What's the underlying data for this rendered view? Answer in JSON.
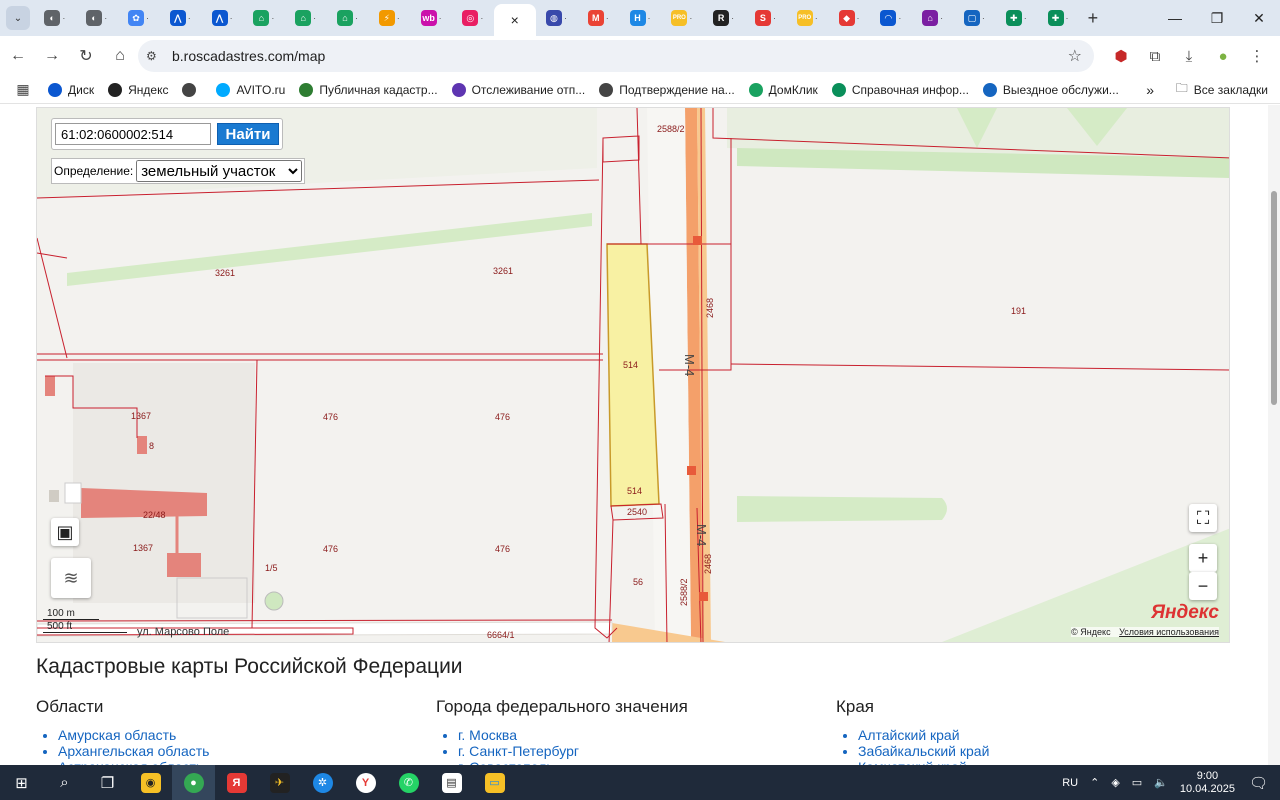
{
  "browser": {
    "address": "b.roscadastres.com/map",
    "tab_favicons": [
      {
        "color": "#5f6368",
        "glyph": "◐"
      },
      {
        "color": "#5f6368",
        "glyph": "◐"
      },
      {
        "color": "#4285f4",
        "glyph": "✿"
      },
      {
        "color": "#0b57d0",
        "glyph": "⋀"
      },
      {
        "color": "#0b57d0",
        "glyph": "⋀"
      },
      {
        "color": "#1aa260",
        "glyph": "⌂"
      },
      {
        "color": "#1aa260",
        "glyph": "⌂"
      },
      {
        "color": "#1aa260",
        "glyph": "⌂"
      },
      {
        "color": "#f29900",
        "glyph": "⚡"
      },
      {
        "color": "#cb11ab",
        "glyph": "wb"
      },
      {
        "color": "#e91e63",
        "glyph": "◎"
      },
      {
        "color": "#ffffff",
        "glyph": "×",
        "active": true
      },
      {
        "color": "#3949ab",
        "glyph": "◍"
      },
      {
        "color": "#ea4335",
        "glyph": "M"
      },
      {
        "color": "#1e88e5",
        "glyph": "H"
      },
      {
        "color": "#f6bf26",
        "glyph": "PRO"
      },
      {
        "color": "#222222",
        "glyph": "R"
      },
      {
        "color": "#e53935",
        "glyph": "S"
      },
      {
        "color": "#f6bf26",
        "glyph": "PRO"
      },
      {
        "color": "#e53935",
        "glyph": "◆"
      },
      {
        "color": "#0b57d0",
        "glyph": "◠"
      },
      {
        "color": "#7b1fa2",
        "glyph": "⌂"
      },
      {
        "color": "#1565c0",
        "glyph": "▢"
      },
      {
        "color": "#0a8f5a",
        "glyph": "✚"
      },
      {
        "color": "#0a8f5a",
        "glyph": "✚"
      }
    ]
  },
  "bookmarks": [
    {
      "label": "Диск",
      "color": "#0b57d0"
    },
    {
      "label": "Яндекс",
      "color": "#222222"
    },
    {
      "label": "",
      "color": "#444444"
    },
    {
      "label": "AVITO.ru",
      "color": "#00aaff"
    },
    {
      "label": "Публичная кадастр...",
      "color": "#2e7d32"
    },
    {
      "label": "Отслеживание отп...",
      "color": "#5e35b1"
    },
    {
      "label": "Подтверждение на...",
      "color": "#444444"
    },
    {
      "label": "ДомКлик",
      "color": "#1aa260"
    },
    {
      "label": "Справочная инфор...",
      "color": "#0a8f5a"
    },
    {
      "label": "Выездное обслужи...",
      "color": "#1565c0"
    }
  ],
  "bookmarks_all": "Все закладки",
  "map": {
    "search_value": "61:02:0600002:514",
    "search_button": "Найти",
    "definition_label": "Определение:",
    "definition_value": "земельный участок",
    "scale_m": "100 m",
    "scale_ft": "500 ft",
    "street": "ул. Марсово Поле",
    "yandex_logo": "Яндекс",
    "copyright": "© Яндекс",
    "terms": "Условия использования",
    "labels": {
      "l3261a": "3261",
      "l3261b": "3261",
      "l2588a": "2588/2",
      "l2468a": "2468",
      "l191": "191",
      "l514a": "514",
      "l514b": "514",
      "lM4a": "М-4",
      "lM4b": "М-4",
      "l1367a": "1367",
      "l1367b": "1367",
      "l476a": "476",
      "l476b": "476",
      "l476c": "476",
      "l476d": "476",
      "l2248": "22/48",
      "l2540": "2540",
      "l56": "56",
      "l2588b": "2588/2",
      "l2468b": "2468",
      "l6664": "6664/1",
      "l8": "8",
      "l15": "1/5"
    }
  },
  "content": {
    "title": "Кадастровые карты Российской Федерации",
    "columns": [
      {
        "heading": "Области",
        "items": [
          "Амурская область",
          "Архангельская область",
          "Астраханская область"
        ]
      },
      {
        "heading": "Города федерального значения",
        "items": [
          "г. Москва",
          "г. Санкт-Петербург",
          "г. Севастополь"
        ]
      },
      {
        "heading": "Края",
        "items": [
          "Алтайский край",
          "Забайкальский край",
          "Камчатский край"
        ]
      }
    ]
  },
  "taskbar": {
    "lang": "RU",
    "time": "9:00",
    "date": "10.04.2025"
  }
}
